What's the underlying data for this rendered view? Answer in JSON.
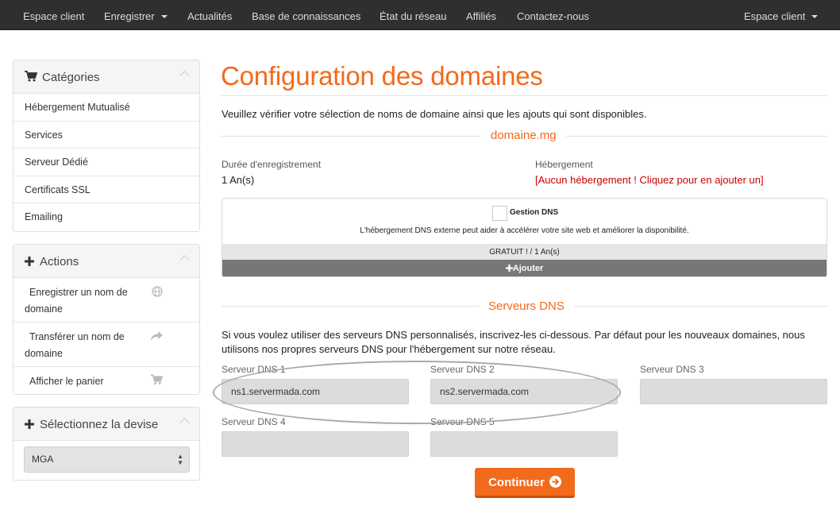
{
  "nav": {
    "client_area": "Espace client",
    "register": "Enregistrer",
    "news": "Actualités",
    "knowledgebase": "Base de connaissances",
    "network_status": "État du réseau",
    "affiliates": "Affiliés",
    "contact": "Contactez-nous",
    "account_menu": "Espace client"
  },
  "sidebar": {
    "categories": {
      "title": "Catégories",
      "items": [
        "Hébergement Mutualisé",
        "Services",
        "Serveur Dédié",
        "Certificats SSL",
        "Emailing"
      ]
    },
    "actions": {
      "title": "Actions",
      "items": [
        {
          "label": "Enregistrer un nom de domaine",
          "icon": "globe-icon"
        },
        {
          "label": "Transférer un nom de domaine",
          "icon": "share-arrow-icon"
        },
        {
          "label": "Afficher le panier",
          "icon": "cart-icon"
        }
      ]
    },
    "currency": {
      "title": "Sélectionnez la devise",
      "selected": "MGA"
    }
  },
  "main": {
    "title": "Configuration des domaines",
    "intro": "Veuillez vérifier votre sélection de noms de domaine ainsi que les ajouts qui sont disponibles.",
    "domain": "domaine.mg",
    "reg_period_label": "Durée d'enregistrement",
    "reg_period_value": "1 An(s)",
    "hosting_label": "Hébergement",
    "hosting_link": "[Aucun hébergement ! Cliquez pour en ajouter un]",
    "addon": {
      "name": "Gestion DNS",
      "description": "L'hébergement DNS externe peut aider à accélérer votre site web et améliorer la disponibilité.",
      "price": "GRATUIT ! / 1 An(s)",
      "add_button": "Ajouter"
    },
    "dns_section_title": "Serveurs DNS",
    "dns_text": "Si vous voulez utiliser des serveurs DNS personnalisés, inscrivez-les ci-dessous. Par défaut pour les nouveaux domaines, nous utilisons nos propres serveurs DNS pour l'hébergement sur notre réseau.",
    "nameservers": [
      {
        "label": "Serveur DNS 1",
        "value": "ns1.servermada.com"
      },
      {
        "label": "Serveur DNS 2",
        "value": "ns2.servermada.com"
      },
      {
        "label": "Serveur DNS 3",
        "value": ""
      },
      {
        "label": "Serveur DNS 4",
        "value": ""
      },
      {
        "label": "Serveur DNS 5",
        "value": ""
      }
    ],
    "continue_button": "Continuer"
  },
  "colors": {
    "accent": "#f26a1b",
    "navbar": "#2f2f2f",
    "link_red": "#cc0000"
  }
}
